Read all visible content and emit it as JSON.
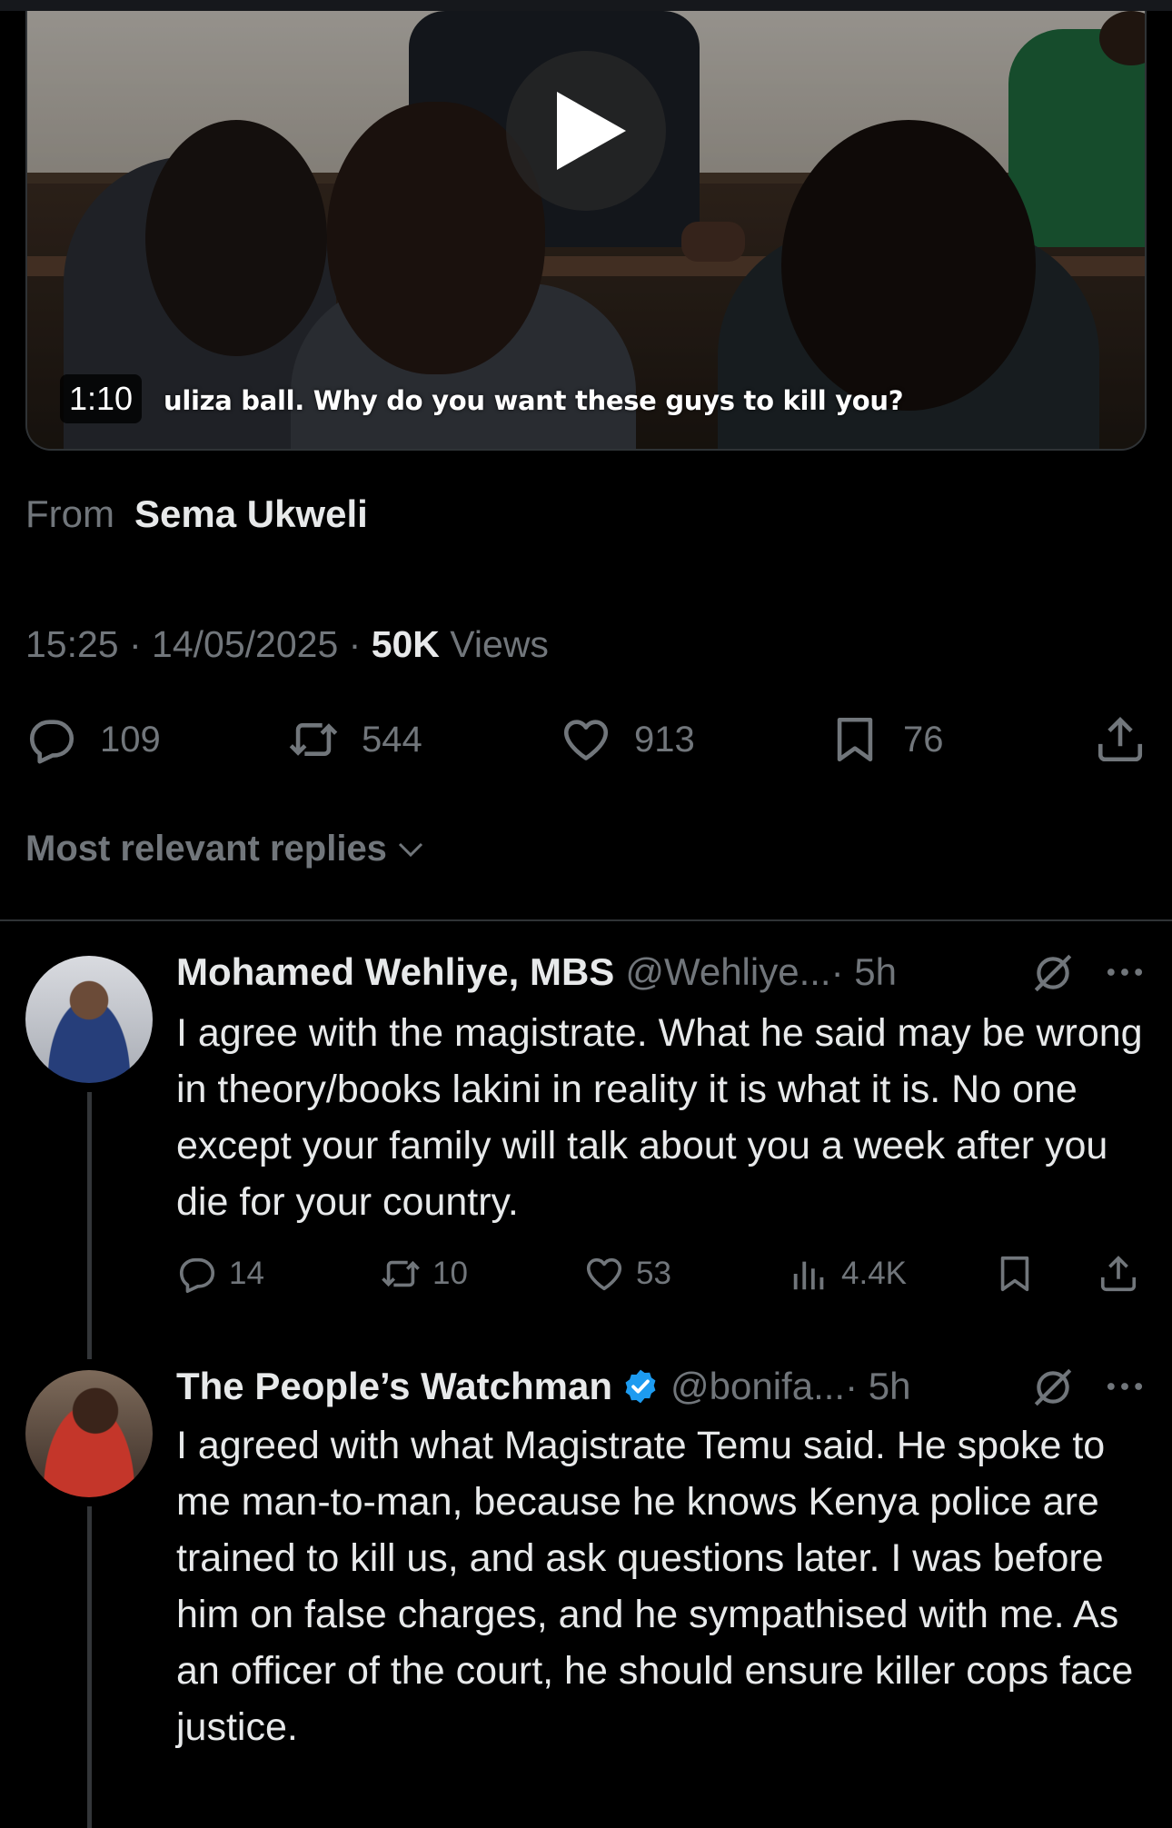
{
  "video": {
    "duration": "1:10",
    "caption": "uliza ball. Why do you want these guys to kill you?"
  },
  "source": {
    "from_label": "From",
    "name": "Sema Ukweli"
  },
  "meta": {
    "time": "15:25",
    "sep1": " · ",
    "date": "14/05/2025",
    "sep2": " · ",
    "views_count": "50K",
    "views_label": " Views"
  },
  "actions": {
    "replies": "109",
    "reposts": "544",
    "likes": "913",
    "bookmarks": "76"
  },
  "sort": {
    "label": "Most relevant replies"
  },
  "replies": [
    {
      "name": "Mohamed Wehliye, MBS",
      "handle": "@Wehliye...",
      "time": " · 5h",
      "text": "I agree with the magistrate. What he said may be wrong in theory/books lakini in reality it is what it is. No one except your family will talk about you a week after you die for your country.",
      "replies": "14",
      "reposts": "10",
      "likes": "53",
      "views": "4.4K"
    },
    {
      "name": "The People’s Watchman",
      "handle": "@bonifa...",
      "time": " · 5h",
      "text": "I agreed with what Magistrate Temu said. He spoke to me man-to-man, because he knows Kenya police are trained to kill us, and ask questions later. I was before him on false charges, and he sympathised with me. As an officer of the court, he should ensure killer cops face justice."
    }
  ],
  "colors": {
    "background": "#000000",
    "text": "#e7e9ea",
    "muted": "#71767b",
    "verified": "#1d9bf0",
    "divider": "#2f3336"
  }
}
